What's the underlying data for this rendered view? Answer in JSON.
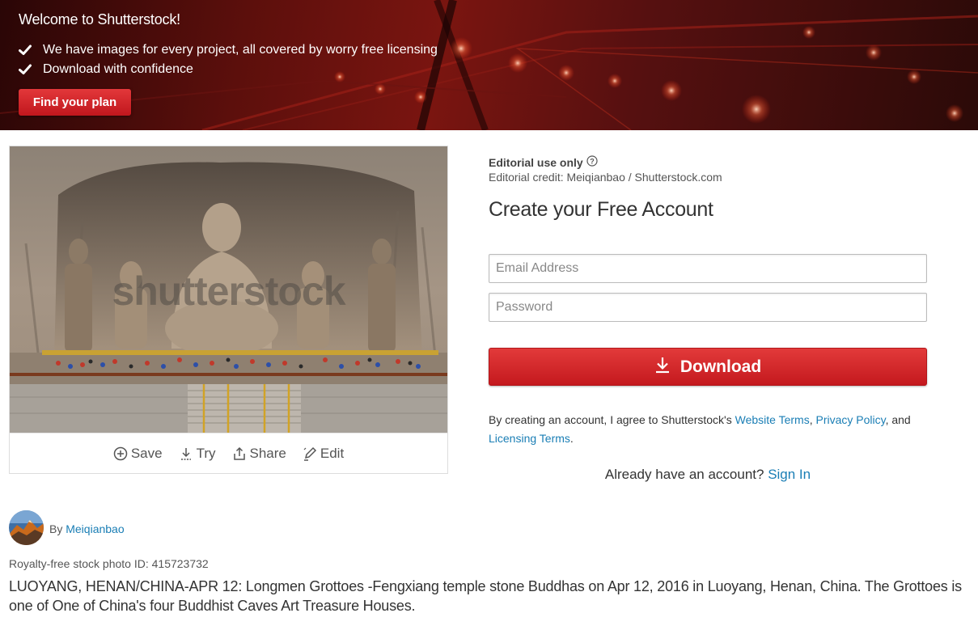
{
  "banner": {
    "title": "Welcome to Shutterstock!",
    "benefits": [
      "We have images for every project, all covered by worry free licensing",
      "Download with confidence"
    ],
    "cta_label": "Find your plan"
  },
  "image": {
    "watermark": "shutterstock",
    "actions": [
      {
        "label": "Save",
        "icon": "plus-circle-icon"
      },
      {
        "label": "Try",
        "icon": "download-icon"
      },
      {
        "label": "Share",
        "icon": "share-icon"
      },
      {
        "label": "Edit",
        "icon": "edit-icon"
      }
    ]
  },
  "editorial": {
    "title": "Editorial use only",
    "credit": "Editorial credit: Meiqianbao / Shutterstock.com"
  },
  "signup": {
    "title": "Create your Free Account",
    "email_placeholder": "Email Address",
    "password_placeholder": "Password",
    "download_label": "Download",
    "terms_prefix": "By creating an account, I agree to Shutterstock's ",
    "terms_link_1": "Website Terms",
    "terms_sep_1": ", ",
    "terms_link_2": "Privacy Policy",
    "terms_sep_2": ", and",
    "terms_link_3": "Licensing Terms",
    "terms_suffix": ".",
    "signin_prompt": "Already have an account? ",
    "signin_link": "Sign In"
  },
  "contributor": {
    "by_label": "By ",
    "name": "Meiqianbao"
  },
  "photo_id_text": "Royalty-free stock photo ID: 415723732",
  "description": "LUOYANG, HENAN/CHINA-APR 12: Longmen Grottoes -Fengxiang temple stone Buddhas on Apr 12, 2016 in Luoyang, Henan, China. The Grottoes is one of One of China's four Buddhist Caves Art Treasure Houses.",
  "colors": {
    "brand_red": "#c4191e",
    "link_blue": "#1a7eb5"
  }
}
